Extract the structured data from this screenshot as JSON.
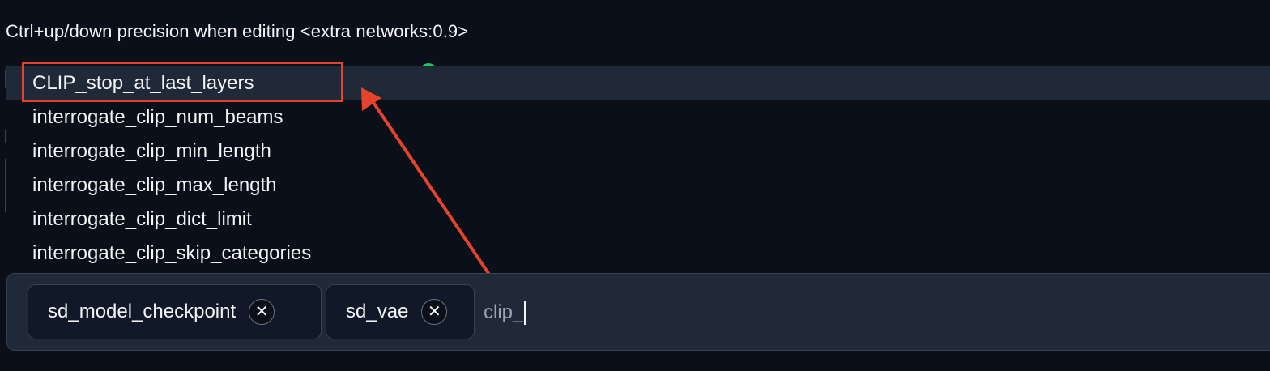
{
  "hint": {
    "text": "Ctrl+up/down precision when editing <extra networks:0.9>"
  },
  "dropdown": {
    "items": [
      {
        "label": "CLIP_stop_at_last_layers",
        "selected": true
      },
      {
        "label": "interrogate_clip_num_beams",
        "selected": false
      },
      {
        "label": "interrogate_clip_min_length",
        "selected": false
      },
      {
        "label": "interrogate_clip_max_length",
        "selected": false
      },
      {
        "label": "interrogate_clip_dict_limit",
        "selected": false
      },
      {
        "label": "interrogate_clip_skip_categories",
        "selected": false
      }
    ]
  },
  "token_input": {
    "chips": [
      {
        "label": "sd_model_checkpoint",
        "remove_icon": "close-icon"
      },
      {
        "label": "sd_vae",
        "remove_icon": "close-icon"
      }
    ],
    "typed_text": "clip_"
  },
  "colors": {
    "background": "#0b0f19",
    "panel": "#1f2937",
    "chip": "#111827",
    "annotation": "#e5432b",
    "status_dot": "#22c55e"
  }
}
